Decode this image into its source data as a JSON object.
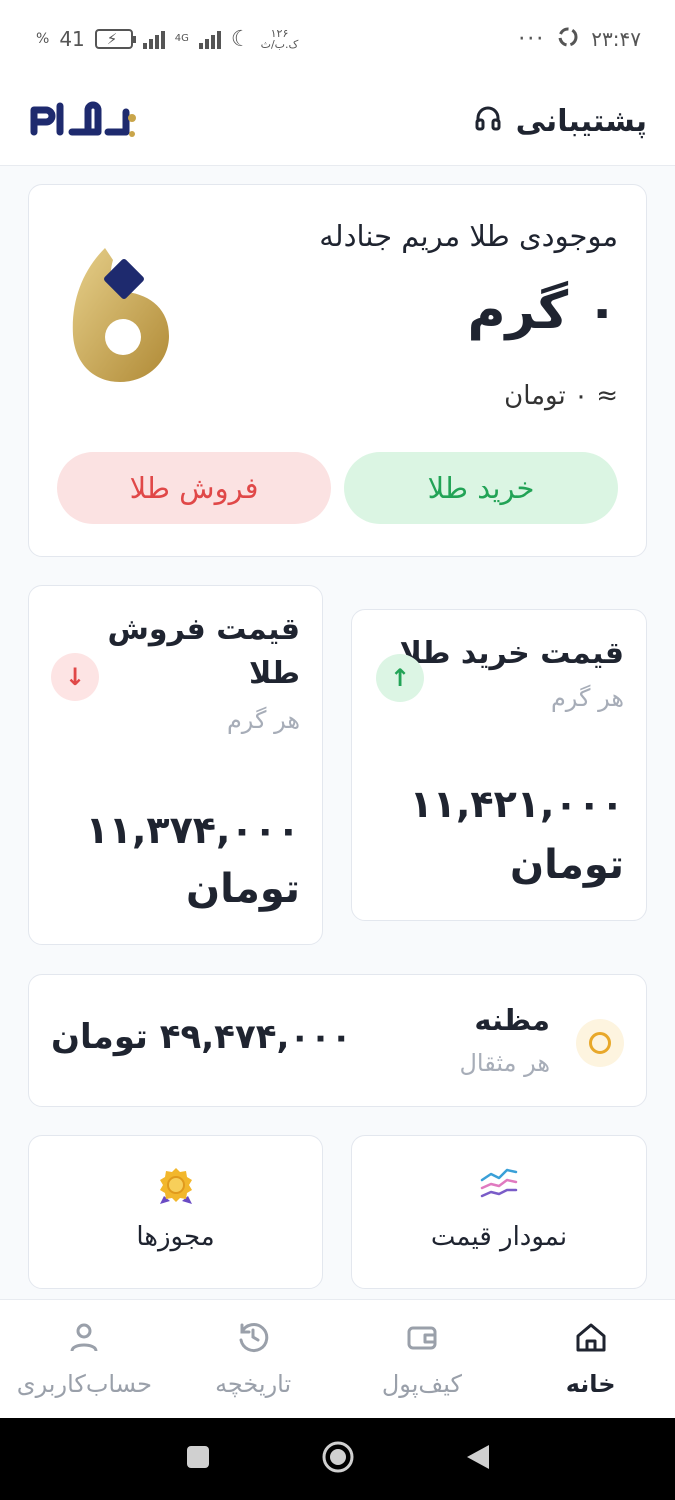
{
  "status_bar": {
    "battery": "41",
    "battery_pct_sign": "%",
    "network": "4G",
    "data_speed_value": "۱۲۶",
    "data_speed_unit": "ک.ب/ث",
    "dots": "···",
    "time": "۲۳:۴۷"
  },
  "header": {
    "brand": "طلاپ",
    "support_label": "پشتیبانی"
  },
  "balance": {
    "title": "موجودی طلا مریم جنادله",
    "grams": "۰ گرم",
    "toman": "≈ ۰ تومان",
    "buy_label": "خرید طلا",
    "sell_label": "فروش طلا"
  },
  "prices": {
    "buy": {
      "title": "قیمت خرید طلا",
      "sub": "هر گرم",
      "price": "۱۱,۴۲۱,۰۰۰",
      "unit": "تومان"
    },
    "sell": {
      "title_line1": "قیمت فروش",
      "title_line2": "طلا",
      "sub": "هر گرم",
      "price": "۱۱,۳۷۴,۰۰۰",
      "unit": "تومان"
    }
  },
  "mazneh": {
    "title": "مظنه",
    "sub": "هر مثقال",
    "price": "۴۹,۴۷۴,۰۰۰ تومان"
  },
  "features": {
    "chart_label": "نمودار قیمت",
    "licenses_label": "مجوزها"
  },
  "bottom_nav": [
    {
      "label": "خانه",
      "icon": "home-icon",
      "active": true
    },
    {
      "label": "کیف‌پول",
      "icon": "wallet-icon",
      "active": false
    },
    {
      "label": "تاریخچه",
      "icon": "history-icon",
      "active": false
    },
    {
      "label": "حساب‌کاربری",
      "icon": "user-icon",
      "active": false
    }
  ],
  "colors": {
    "brand_navy": "#1e2a6e",
    "gold": "#c9a54a",
    "green": "#22a356",
    "red": "#e04848"
  }
}
